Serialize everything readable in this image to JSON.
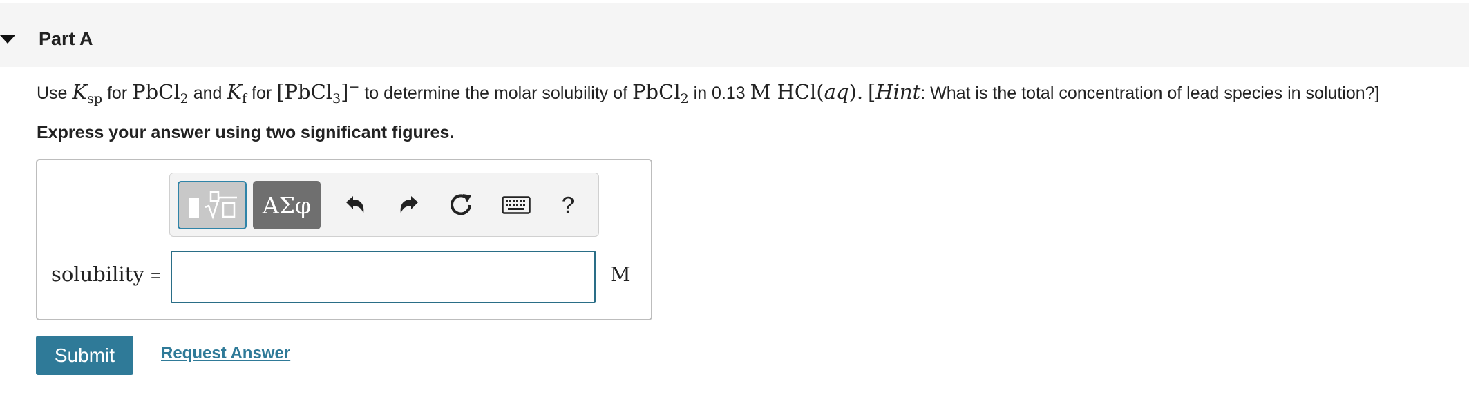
{
  "part": {
    "title": "Part A"
  },
  "question": {
    "t_use": "Use",
    "ksp_K": "K",
    "ksp_sub": "sp",
    "t_for1": "for",
    "pbcl2_a": "PbCl",
    "pbcl2_a_sub": "2",
    "t_and": "and",
    "kf_K": "K",
    "kf_sub": "f",
    "t_for2": "for",
    "complex": "[PbCl",
    "complex_sub": "3",
    "complex_close": "]",
    "complex_sup": "−",
    "t_determine": "to determine the molar solubility of",
    "pbcl2_b": "PbCl",
    "pbcl2_b_sub": "2",
    "t_in": "in 0.13",
    "conc_unit": "M",
    "hcl": "HCl(",
    "aq": "aq",
    "hcl_close": ").",
    "hint_open": "[",
    "hint_word": "Hint",
    "hint_text": ": What is the total concentration of lead species in solution?]"
  },
  "instruction": "Express your answer using two significant figures.",
  "toolbar": {
    "greek_label": "ΑΣφ",
    "help_label": "?"
  },
  "answer": {
    "label": "solubility",
    "equals": "=",
    "value": "",
    "unit": "M"
  },
  "actions": {
    "submit_label": "Submit",
    "request_label": "Request Answer"
  },
  "colors": {
    "accent": "#2f7a98",
    "header_bg": "#f5f5f5",
    "greek_button": "#6f6f6f",
    "input_border": "#2a6e87"
  },
  "icons": [
    "caret-down-icon",
    "templates-icon",
    "undo-icon",
    "redo-icon",
    "reset-icon",
    "keyboard-icon"
  ]
}
